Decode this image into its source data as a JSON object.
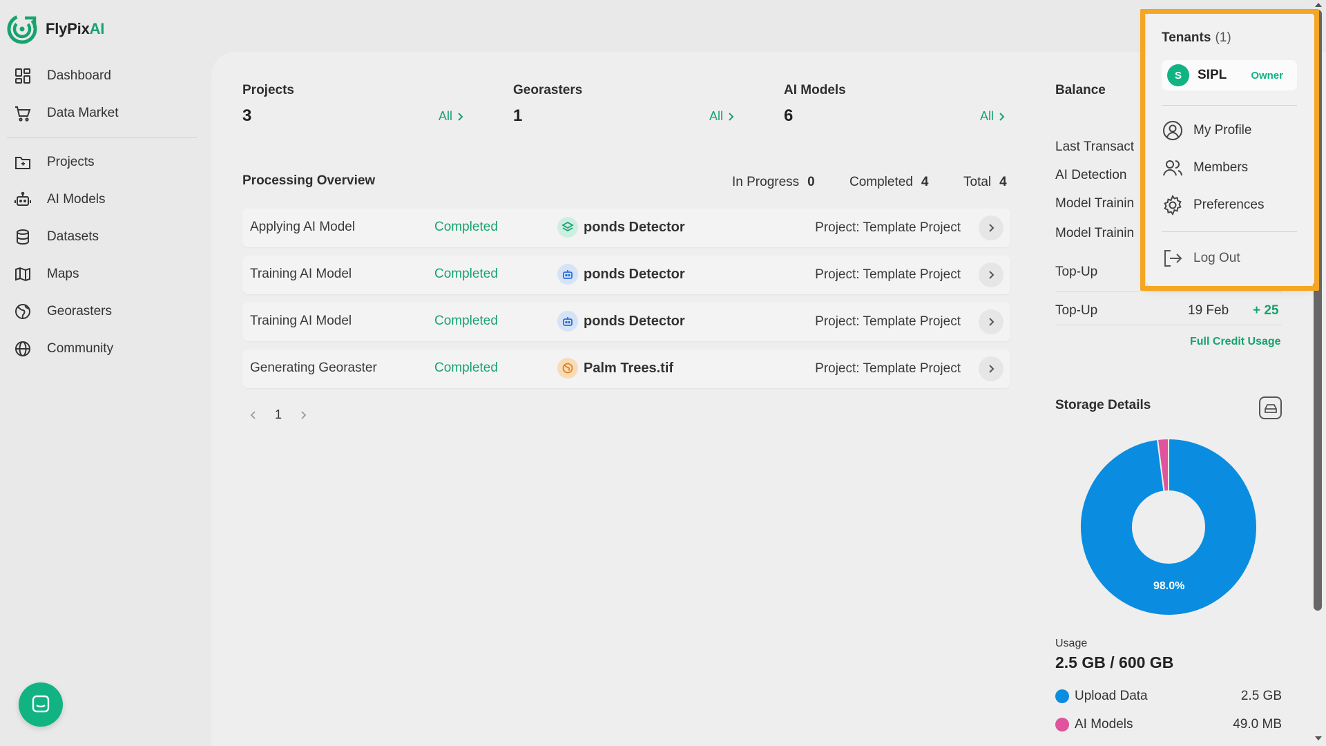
{
  "app": {
    "name_main": "FlyPix",
    "name_accent": "AI"
  },
  "sidebar": {
    "items": [
      {
        "label": "Dashboard",
        "icon": "dashboard-icon"
      },
      {
        "label": "Data Market",
        "icon": "cart-icon"
      },
      {
        "label": "Projects",
        "icon": "folder-icon"
      },
      {
        "label": "AI Models",
        "icon": "robot-icon"
      },
      {
        "label": "Datasets",
        "icon": "database-icon"
      },
      {
        "label": "Maps",
        "icon": "map-icon"
      },
      {
        "label": "Georasters",
        "icon": "georaster-icon"
      },
      {
        "label": "Community",
        "icon": "globe-icon"
      }
    ]
  },
  "stats": [
    {
      "label": "Projects",
      "value": "3",
      "link": "All"
    },
    {
      "label": "Georasters",
      "value": "1",
      "link": "All"
    },
    {
      "label": "AI Models",
      "value": "6",
      "link": "All"
    }
  ],
  "processing": {
    "title": "Processing Overview",
    "in_progress_label": "In Progress",
    "in_progress": "0",
    "completed_label": "Completed",
    "completed": "4",
    "total_label": "Total",
    "total": "4",
    "rows": [
      {
        "task": "Applying AI Model",
        "status": "Completed",
        "asset": "ponds Detector",
        "asset_icon": "layers-icon",
        "project": "Project: Template Project"
      },
      {
        "task": "Training AI Model",
        "status": "Completed",
        "asset": "ponds Detector",
        "asset_icon": "robot-icon",
        "project": "Project: Template Project"
      },
      {
        "task": "Training AI Model",
        "status": "Completed",
        "asset": "ponds Detector",
        "asset_icon": "robot-icon",
        "project": "Project: Template Project"
      },
      {
        "task": "Generating Georaster",
        "status": "Completed",
        "asset": "Palm Trees.tif",
        "asset_icon": "globe-icon",
        "project": "Project: Template Project"
      }
    ],
    "page": "1"
  },
  "balance": {
    "title": "Balance",
    "rows": [
      {
        "label": "Last Transact"
      },
      {
        "label": "AI Detection"
      },
      {
        "label": "Model Trainin"
      },
      {
        "label": "Model Trainin"
      },
      {
        "label": "Top-Up"
      },
      {
        "label": "Top-Up",
        "date": "19 Feb",
        "amount": "+ 25"
      }
    ],
    "full_credit_link": "Full Credit Usage"
  },
  "storage": {
    "title": "Storage Details",
    "usage_label": "Usage",
    "usage_value": "2.5 GB / 600 GB",
    "percent_label": "98.0%",
    "legend": [
      {
        "name": "Upload Data",
        "value": "2.5 GB",
        "color": "#0a8de0"
      },
      {
        "name": "AI Models",
        "value": "49.0 MB",
        "color": "#e0549e"
      }
    ]
  },
  "chart_data": {
    "type": "pie",
    "categories": [
      "Upload Data",
      "AI Models"
    ],
    "values": [
      98.0,
      2.0
    ]
  },
  "dropdown": {
    "title": "Tenants",
    "count": "(1)",
    "tenant": {
      "initial": "S",
      "name": "SIPL",
      "role": "Owner"
    },
    "items": [
      {
        "label": "My Profile",
        "icon": "profile-icon"
      },
      {
        "label": "Members",
        "icon": "members-icon"
      },
      {
        "label": "Preferences",
        "icon": "gear-icon"
      }
    ],
    "logout": "Log Out"
  },
  "colors": {
    "accent": "#16a36f",
    "highlight": "#f5a623",
    "chart_primary": "#0a8de0",
    "chart_secondary": "#e0549e"
  }
}
